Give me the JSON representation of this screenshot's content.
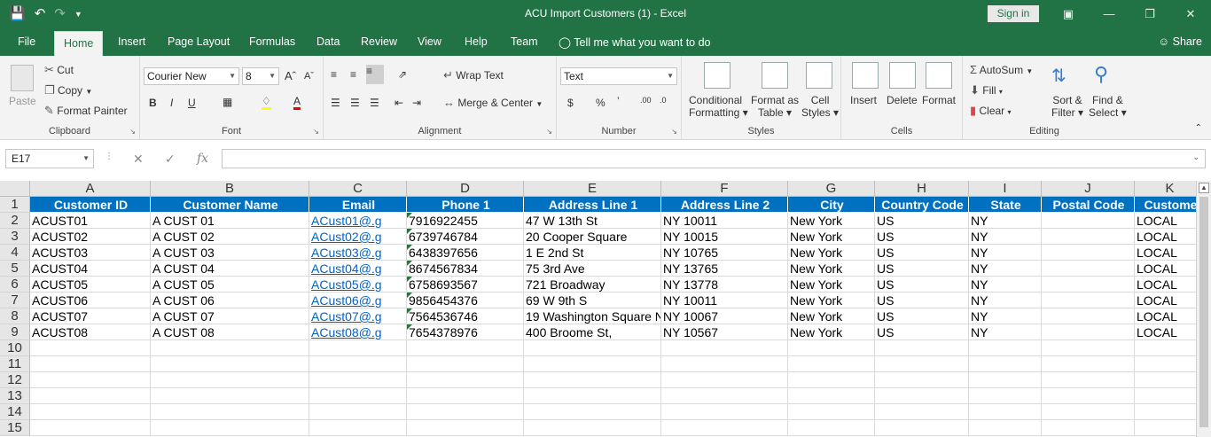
{
  "window": {
    "title": "ACU Import Customers (1)  -  Excel",
    "sign_in": "Sign in"
  },
  "tabs": [
    "File",
    "Home",
    "Insert",
    "Page Layout",
    "Formulas",
    "Data",
    "Review",
    "View",
    "Help",
    "Team"
  ],
  "tell_me": "Tell me what you want to do",
  "share": "Share",
  "ribbon": {
    "clipboard": {
      "label": "Clipboard",
      "paste": "Paste",
      "cut": "Cut",
      "copy": "Copy",
      "format_painter": "Format Painter"
    },
    "font": {
      "label": "Font",
      "name": "Courier New",
      "size": "8"
    },
    "alignment": {
      "label": "Alignment",
      "wrap": "Wrap Text",
      "merge": "Merge & Center"
    },
    "number": {
      "label": "Number",
      "format": "Text"
    },
    "styles": {
      "label": "Styles",
      "conditional_1": "Conditional",
      "conditional_2": "Formatting",
      "table_1": "Format as",
      "table_2": "Table",
      "cell_1": "Cell",
      "cell_2": "Styles"
    },
    "cells": {
      "label": "Cells",
      "insert": "Insert",
      "delete": "Delete",
      "format": "Format"
    },
    "editing": {
      "label": "Editing",
      "autosum": "AutoSum",
      "fill": "Fill",
      "clear": "Clear",
      "sort_1": "Sort &",
      "sort_2": "Filter",
      "find_1": "Find &",
      "find_2": "Select"
    }
  },
  "formula_bar": {
    "name_box": "E17",
    "formula": ""
  },
  "columns": [
    "A",
    "B",
    "C",
    "D",
    "E",
    "F",
    "G",
    "H",
    "I",
    "J",
    "K"
  ],
  "rows": [
    "1",
    "2",
    "3",
    "4",
    "5",
    "6",
    "7",
    "8",
    "9",
    "10",
    "11",
    "12",
    "13",
    "14",
    "15"
  ],
  "headers": [
    "Customer ID",
    "Customer Name",
    "Email",
    "Phone 1",
    "Address Line 1",
    "Address Line 2",
    "City",
    "Country Code",
    "State",
    "Postal Code",
    "Custome"
  ],
  "data": [
    [
      "ACUST01",
      "A CUST 01",
      "ACust01@.g",
      "7916922455",
      "47 W 13th St",
      "NY 10011",
      "New York",
      "US",
      "NY",
      "",
      "LOCAL"
    ],
    [
      "ACUST02",
      "A CUST 02",
      "ACust02@.g",
      "6739746784",
      "20 Cooper Square",
      "NY 10015",
      "New York",
      "US",
      "NY",
      "",
      "LOCAL"
    ],
    [
      "ACUST03",
      "A CUST 03",
      "ACust03@.g",
      "6438397656",
      "1 E 2nd St",
      "NY 10765",
      "New York",
      "US",
      "NY",
      "",
      "LOCAL"
    ],
    [
      "ACUST04",
      "A CUST 04",
      "ACust04@.g",
      "8674567834",
      "75 3rd Ave",
      "NY 13765",
      "New York",
      "US",
      "NY",
      "",
      "LOCAL"
    ],
    [
      "ACUST05",
      "A CUST 05",
      "ACust05@.g",
      "6758693567",
      "721 Broadway",
      "NY 13778",
      "New York",
      "US",
      "NY",
      "",
      "LOCAL"
    ],
    [
      "ACUST06",
      "A CUST 06",
      "ACust06@.g",
      "9856454376",
      "69 W 9th S",
      "NY 10011",
      "New York",
      "US",
      "NY",
      "",
      "LOCAL"
    ],
    [
      "ACUST07",
      "A CUST 07",
      "ACust07@.g",
      "7564536746",
      "19 Washington Square N",
      "NY 10067",
      "New York",
      "US",
      "NY",
      "",
      "LOCAL"
    ],
    [
      "ACUST08",
      "A CUST 08",
      "ACust08@.g",
      "7654378976",
      "400 Broome St,",
      "NY 10567",
      "New York",
      "US",
      "NY",
      "",
      "LOCAL"
    ]
  ]
}
